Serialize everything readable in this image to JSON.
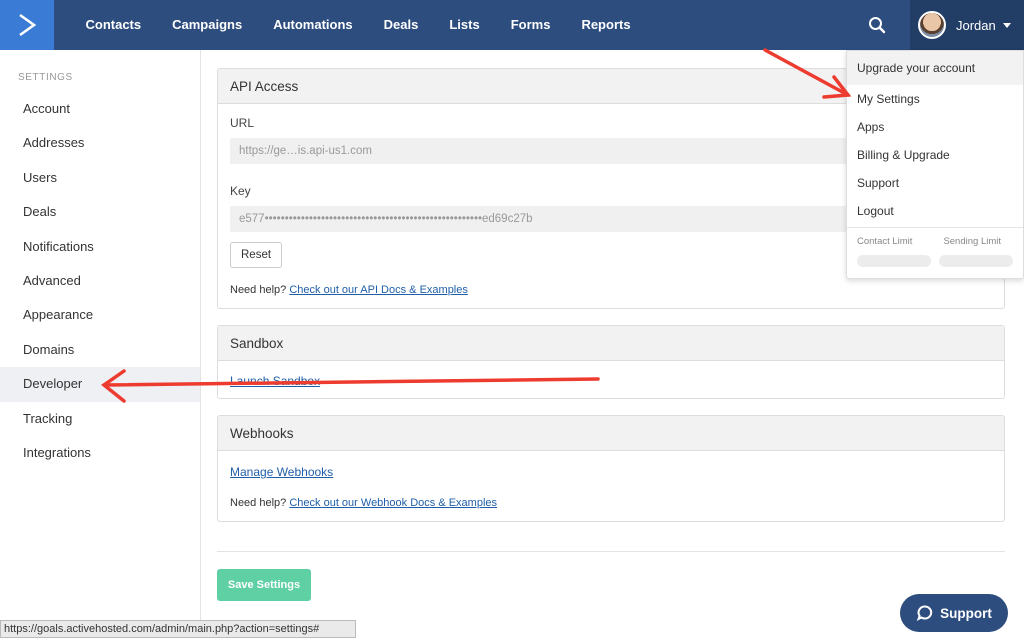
{
  "nav": {
    "items": [
      "Contacts",
      "Campaigns",
      "Automations",
      "Deals",
      "Lists",
      "Forms",
      "Reports"
    ],
    "user_name": "Jordan"
  },
  "sidebar": {
    "heading": "SETTINGS",
    "items": [
      "Account",
      "Addresses",
      "Users",
      "Deals",
      "Notifications",
      "Advanced",
      "Appearance",
      "Domains",
      "Developer",
      "Tracking",
      "Integrations"
    ],
    "active": "Developer"
  },
  "api_access": {
    "title": "API Access",
    "url_label": "URL",
    "url_value": "https://ge…is.api-us1.com",
    "key_label": "Key",
    "key_value": "e577••••••••••••••••••••••••••••••••••••••••••••••••••••••ed69c27b",
    "reset_label": "Reset",
    "help_prefix": "Need help?",
    "help_link": "Check out our API Docs & Examples"
  },
  "sandbox": {
    "title": "Sandbox",
    "link": "Launch Sandbox"
  },
  "webhooks": {
    "title": "Webhooks",
    "link": "Manage Webhooks",
    "help_prefix": "Need help?",
    "help_link": "Check out our Webhook Docs & Examples"
  },
  "save_label": "Save Settings",
  "dropdown": {
    "upgrade": "Upgrade your account",
    "items": [
      "My Settings",
      "Apps",
      "Billing & Upgrade",
      "Support",
      "Logout"
    ],
    "contact_limit": "Contact Limit",
    "sending_limit": "Sending Limit"
  },
  "status_url": "https://goals.activehosted.com/admin/main.php?action=settings#",
  "support_label": "Support",
  "colors": {
    "nav_bg": "#2d4d7f",
    "logo_bg": "#3a7bd5",
    "save_green": "#5fcfa4",
    "link_blue": "#1f5ea8",
    "arrow_red": "#ee3b2f"
  }
}
